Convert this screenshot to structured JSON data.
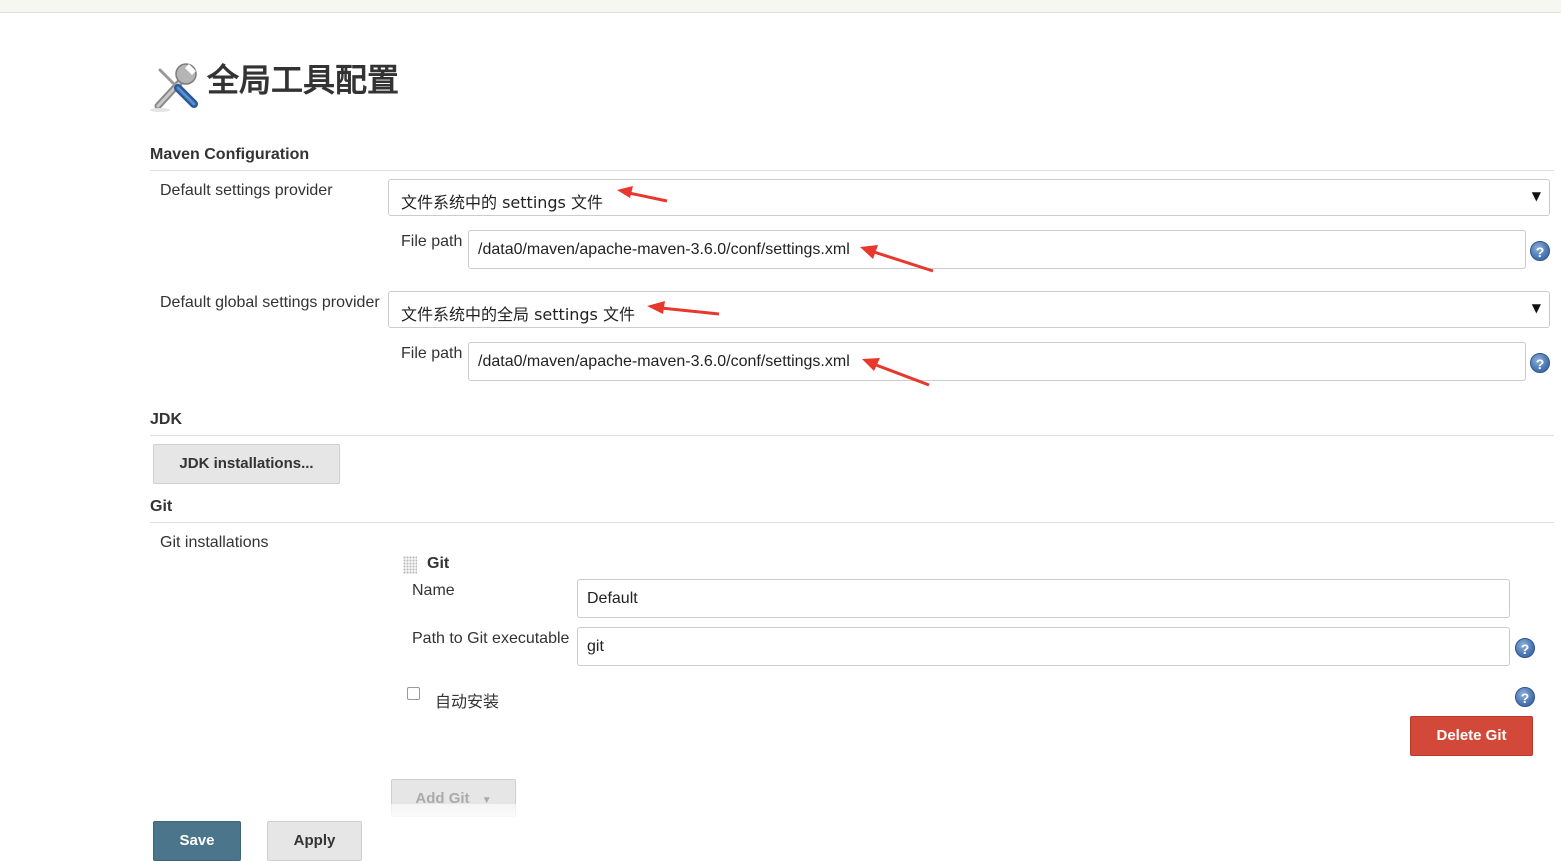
{
  "page": {
    "title": "全局工具配置",
    "title_icon": "tools-icon"
  },
  "maven": {
    "header": "Maven Configuration",
    "settings_provider_label": "Default settings provider",
    "settings_provider_value": "文件系统中的 settings 文件",
    "settings_file_path_label": "File path",
    "settings_file_path_value": "/data0/maven/apache-maven-3.6.0/conf/settings.xml",
    "global_settings_provider_label": "Default global settings provider",
    "global_settings_provider_value": "文件系统中的全局 settings 文件",
    "global_file_path_label": "File path",
    "global_file_path_value": "/data0/maven/apache-maven-3.6.0/conf/settings.xml"
  },
  "jdk": {
    "header": "JDK",
    "installations_button": "JDK installations..."
  },
  "git": {
    "header": "Git",
    "installations_label": "Git installations",
    "entry_title": "Git",
    "name_label": "Name",
    "name_value": "Default",
    "path_label": "Path to Git executable",
    "path_value": "git",
    "auto_install_label": "自动安装",
    "auto_install_checked": false,
    "delete_button": "Delete Git",
    "add_button": "Add Git"
  },
  "actions": {
    "save_label": "Save",
    "apply_label": "Apply"
  },
  "colors": {
    "annotation_arrow": "#e8382e",
    "save_button": "#4b758b",
    "delete_button": "#d24939",
    "help_icon": "#4f79b4"
  }
}
